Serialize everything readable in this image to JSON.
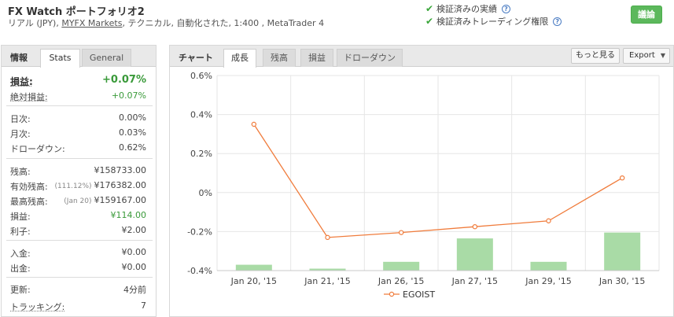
{
  "header": {
    "title": "FX Watch ポートフォリオ2",
    "sub_prefix": "リアル (JPY), ",
    "broker_link": "MYFX Markets",
    "sub_suffix": ", テクニカル, 自動化された, 1:400 , MetaTrader 4",
    "verified_track": "検証済みの実績",
    "verified_trading": "検証済みトレーディング権限",
    "discuss_label": "議論"
  },
  "stats_panel": {
    "label": "情報",
    "tabs": [
      "Stats",
      "General"
    ],
    "active_tab": 0,
    "gain": {
      "label": "損益:",
      "value": "+0.07%"
    },
    "abs_gain": {
      "label": "絶対損益:",
      "value": "+0.07%"
    },
    "daily": {
      "label": "日次:",
      "value": "0.00%"
    },
    "monthly": {
      "label": "月次:",
      "value": "0.03%"
    },
    "drawdown": {
      "label": "ドローダウン:",
      "value": "0.62%"
    },
    "balance": {
      "label": "残高:",
      "value": "¥158733.00"
    },
    "equity": {
      "label": "有効残高:",
      "note": "(111.12%)",
      "value": "¥176382.00"
    },
    "highest": {
      "label": "最高残高:",
      "note": "(Jan 20)",
      "value": "¥159167.00"
    },
    "profit": {
      "label": "損益:",
      "value": "¥114.00"
    },
    "interest": {
      "label": "利子:",
      "value": "¥2.00"
    },
    "deposits": {
      "label": "入金:",
      "value": "¥0.00"
    },
    "withdrawals": {
      "label": "出金:",
      "value": "¥0.00"
    },
    "updated": {
      "label": "更新:",
      "value": "4分前"
    },
    "tracking": {
      "label": "トラッキング:",
      "value": "7"
    }
  },
  "chart_panel": {
    "label": "チャート",
    "tabs": [
      "成長",
      "残高",
      "損益",
      "ドローダウン"
    ],
    "active_tab": 0,
    "more_label": "もっと見る",
    "export_label": "Export"
  },
  "colors": {
    "line": "#f07c3c",
    "bar": "#a9dba6",
    "green_text": "#3a9a3a",
    "button": "#5cb85c"
  },
  "chart_data": {
    "type": "line",
    "categories": [
      "Jan 20, '15",
      "Jan 21, '15",
      "Jan 26, '15",
      "Jan 27, '15",
      "Jan 29, '15",
      "Jan 30, '15"
    ],
    "series": [
      {
        "name": "EGOIST",
        "type": "line",
        "values": [
          0.35,
          -0.23,
          -0.205,
          -0.175,
          -0.145,
          0.075
        ]
      },
      {
        "name": "",
        "type": "bar",
        "values": [
          -0.37,
          -0.39,
          -0.355,
          -0.235,
          -0.355,
          -0.205
        ]
      }
    ],
    "y_ticks": [
      "0.6%",
      "0.4%",
      "0.2%",
      "0%",
      "-0.2%",
      "-0.4%"
    ],
    "ylim": [
      -0.4,
      0.6
    ],
    "bar_base": -0.4,
    "grid": true,
    "legend": "bottom-center"
  }
}
